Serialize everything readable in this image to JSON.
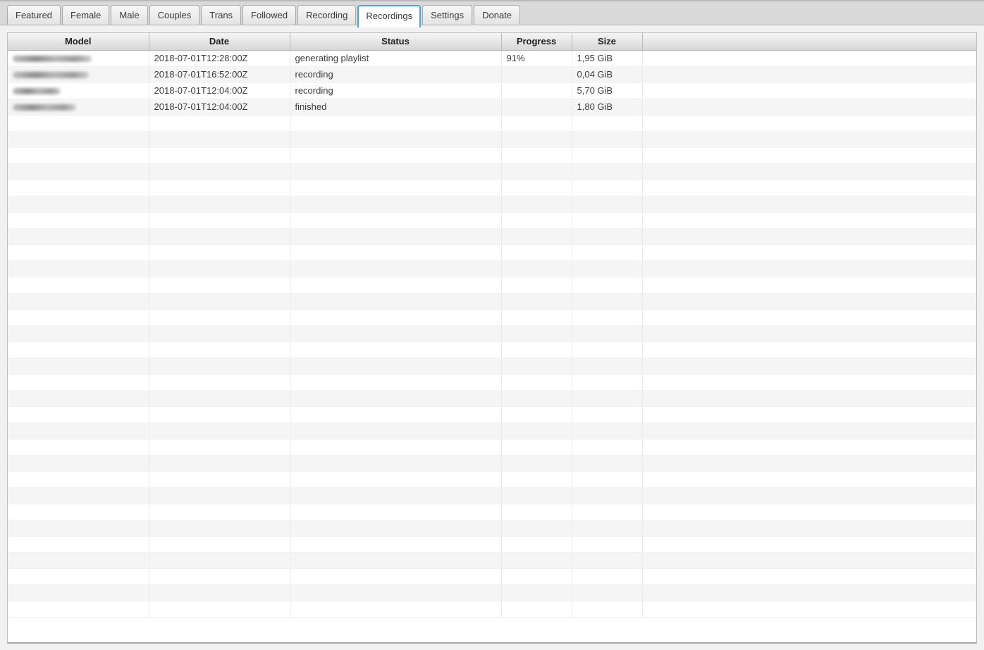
{
  "tabs": [
    {
      "label": "Featured",
      "selected": false
    },
    {
      "label": "Female",
      "selected": false
    },
    {
      "label": "Male",
      "selected": false
    },
    {
      "label": "Couples",
      "selected": false
    },
    {
      "label": "Trans",
      "selected": false
    },
    {
      "label": "Followed",
      "selected": false
    },
    {
      "label": "Recording",
      "selected": false
    },
    {
      "label": "Recordings",
      "selected": true
    },
    {
      "label": "Settings",
      "selected": false
    },
    {
      "label": "Donate",
      "selected": false
    }
  ],
  "table": {
    "columns": [
      "Model",
      "Date",
      "Status",
      "Progress",
      "Size",
      ""
    ],
    "rows": [
      {
        "model_redacted": true,
        "date": "2018-07-01T12:28:00Z",
        "status": "generating playlist",
        "progress": "91%",
        "size": "1,95 GiB"
      },
      {
        "model_redacted": true,
        "date": "2018-07-01T16:52:00Z",
        "status": "recording",
        "progress": "",
        "size": "0,04 GiB"
      },
      {
        "model_redacted": true,
        "date": "2018-07-01T12:04:00Z",
        "status": "recording",
        "progress": "",
        "size": "5,70 GiB"
      },
      {
        "model_redacted": true,
        "date": "2018-07-01T12:04:00Z",
        "status": "finished",
        "progress": "",
        "size": "1,80 GiB"
      }
    ],
    "empty_row_count": 31
  },
  "colors": {
    "selected_tab_border": "#47a7d8",
    "header_gradient_top": "#f5f5f5",
    "header_gradient_bottom": "#d7d7d7",
    "row_alt": "#f5f5f5",
    "strip_bg": "#d9d9d9"
  }
}
